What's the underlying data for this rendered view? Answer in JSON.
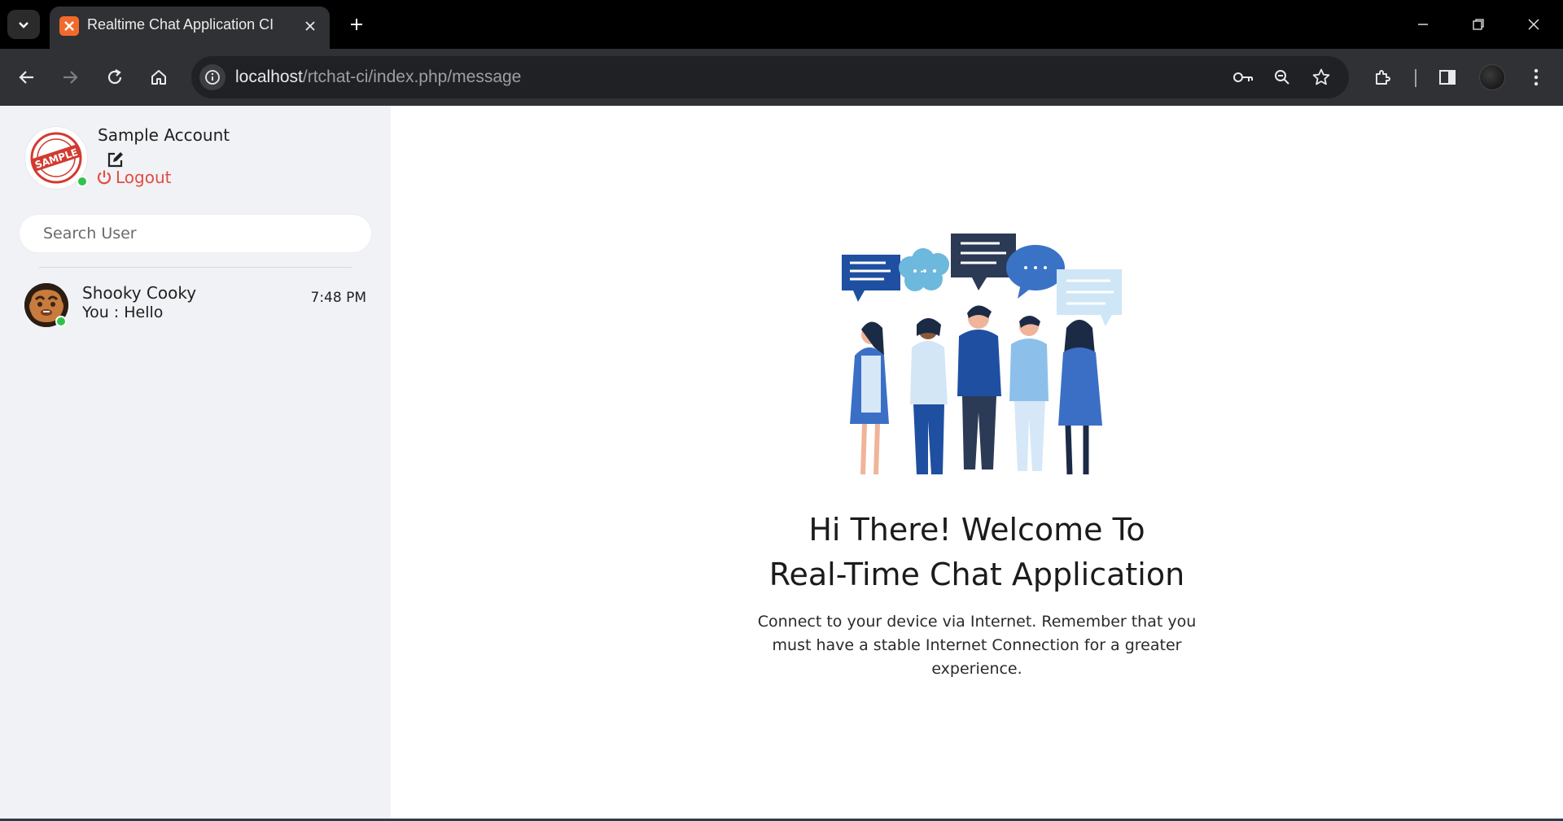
{
  "browser": {
    "tab_title": "Realtime Chat Application CI",
    "url_host": "localhost",
    "url_path": "/rtchat-ci/index.php/message"
  },
  "user": {
    "name": "Sample Account",
    "logout_label": "Logout",
    "avatar_text": "SAMPLE"
  },
  "search": {
    "placeholder": "Search User"
  },
  "chats": [
    {
      "name": "Shooky Cooky",
      "last_message": "You : Hello",
      "time": "7:48 PM",
      "online": true
    }
  ],
  "welcome": {
    "title_line1": "Hi There! Welcome To",
    "title_line2": "Real-Time Chat Application",
    "description": "Connect to your device via Internet. Remember that you must have a stable Internet Connection for a greater experience."
  },
  "colors": {
    "accent_red": "#e14d43",
    "online_green": "#31c24d",
    "sidebar_bg": "#f0f2f5"
  },
  "icons": [
    "tab-search-icon",
    "close-icon",
    "plus-icon",
    "minimize-icon",
    "restore-icon",
    "window-close-icon",
    "back-arrow-icon",
    "forward-arrow-icon",
    "reload-icon",
    "home-icon",
    "info-icon",
    "key-icon",
    "zoom-icon",
    "star-icon",
    "extensions-icon",
    "side-panel-icon",
    "kebab-menu-icon",
    "edit-icon",
    "power-icon"
  ]
}
